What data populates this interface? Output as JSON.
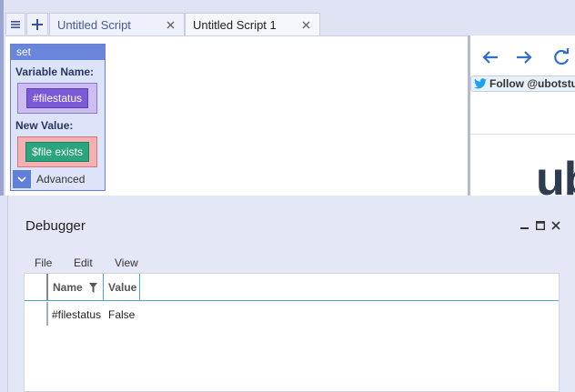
{
  "tabs": [
    {
      "label": "Untitled Script",
      "active": true
    },
    {
      "label": "Untitled Script 1",
      "active": false
    }
  ],
  "set_block": {
    "title": "set",
    "variable_label": "Variable Name:",
    "variable_value": "#filestatus",
    "new_value_label": "New Value:",
    "new_value": "$file exists",
    "advanced_label": "Advanced"
  },
  "browser": {
    "follow_label": "Follow @ubotstud",
    "brand_text": "ub"
  },
  "debugger": {
    "title": "Debugger",
    "menu": [
      "File",
      "Edit",
      "View"
    ],
    "columns": [
      "Name",
      "Value"
    ],
    "rows": [
      {
        "name": "#filestatus",
        "value": "False"
      }
    ]
  },
  "colors": {
    "accent": "#6a86dc",
    "variable_chip": "#7a5ad6",
    "function_chip": "#2aa57d",
    "twitter_blue": "#1da1f2",
    "nav_blue": "#2f6fd0"
  }
}
